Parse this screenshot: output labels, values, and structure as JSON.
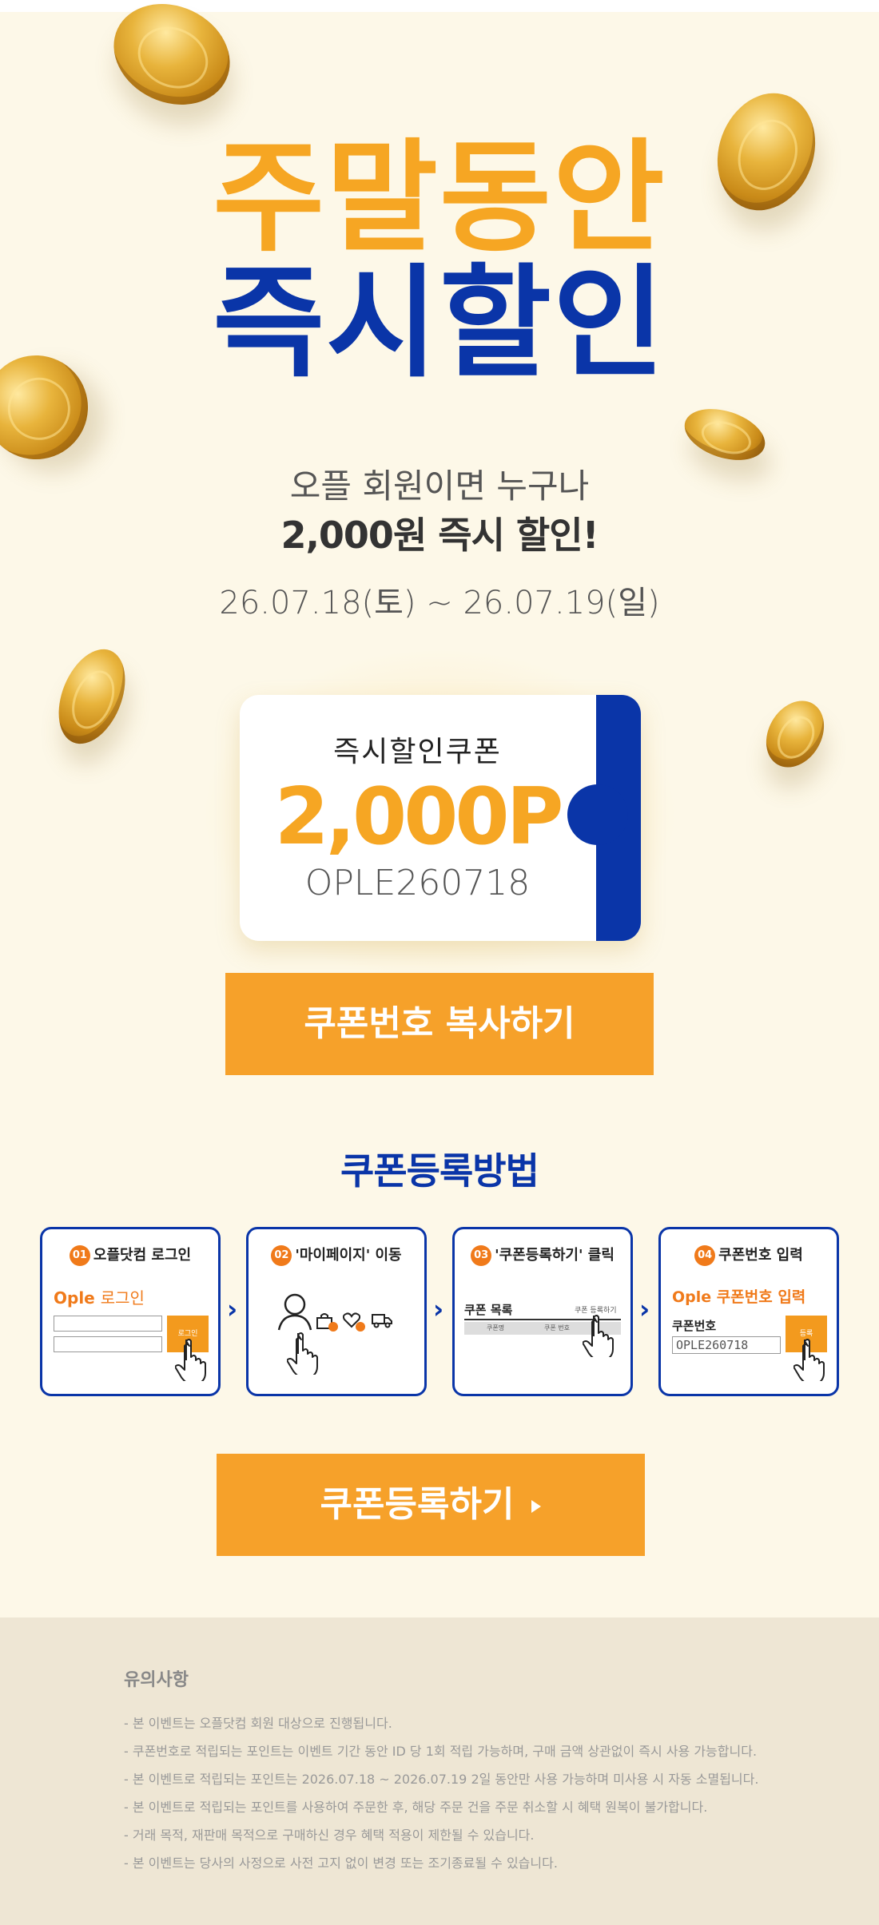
{
  "hero": {
    "title_line1": "주말동안",
    "title_line2": "즉시할인",
    "subtitle_line1": "오플 회원이면 누구나",
    "subtitle_line2": "2,000원 즉시 할인!",
    "date_range": "26.07.18(토) ~ 26.07.19(일)"
  },
  "coupon": {
    "label": "즉시할인쿠폰",
    "amount": "2,000P",
    "code": "OPLE260718"
  },
  "copy_button": {
    "label": "쿠폰번호 복사하기"
  },
  "howto": {
    "title": "쿠폰등록방법",
    "steps": [
      {
        "num": "01",
        "label": "오플닷컴 로그인",
        "brand": "Ople",
        "content": "로그인",
        "button": "로그인"
      },
      {
        "num": "02",
        "label": "'마이페이지' 이동"
      },
      {
        "num": "03",
        "label": "'쿠폰등록하기' 클릭",
        "list_title": "쿠폰 목록",
        "list_action": "쿠폰 등록하기",
        "col1": "쿠폰명",
        "col2": "쿠폰 번호"
      },
      {
        "num": "04",
        "label": "쿠폰번호 입력",
        "brand": "Ople",
        "content": "쿠폰번호 입력",
        "field_label": "쿠폰번호",
        "field_value": "OPLE260718",
        "button": "등록"
      }
    ],
    "arrow": "›"
  },
  "register_button": {
    "label": "쿠폰등록하기"
  },
  "notice": {
    "title": "유의사항",
    "items": [
      "- 본 이벤트는 오플닷컴 회원 대상으로 진행됩니다.",
      "- 쿠폰번호로 적립되는 포인트는 이벤트 기간 동안 ID 당 1회 적립 가능하며, 구매 금액 상관없이 즉시 사용 가능합니다.",
      "- 본 이벤트로 적립되는 포인트는 2026.07.18 ~ 2026.07.19 2일 동안만 사용 가능하며 미사용 시 자동 소멸됩니다.",
      "- 본 이벤트로 적립되는 포인트를 사용하여 주문한 후, 해당 주문 건을 주문 취소할 시 혜택 원복이 불가합니다.",
      "- 거래 목적, 재판매 목적으로 구매하신 경우 혜택 적용이 제한될 수 있습니다.",
      "- 본 이벤트는 당사의 사정으로 사전 고지 없이 변경 또는 조기종료될 수 있습니다."
    ]
  },
  "colors": {
    "orange": "#f6a623",
    "blue": "#0a35a8",
    "background": "#fdf8e8",
    "notice_bg": "#eee6d4"
  }
}
